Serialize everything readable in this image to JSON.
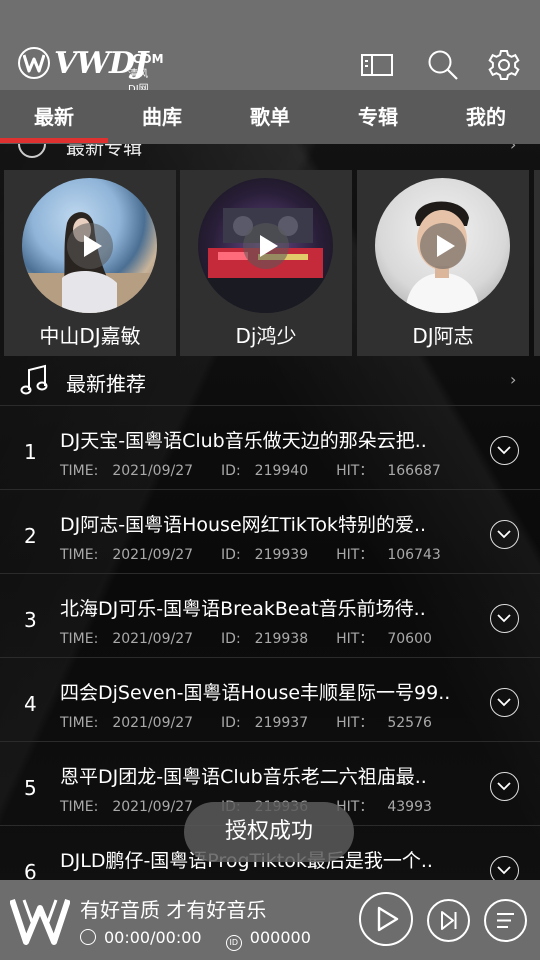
{
  "app": {
    "logo_text": "VWDJ",
    "logo_com": ".COM",
    "logo_sub": "清风DJ网"
  },
  "tabs": [
    {
      "label": "最新",
      "active": true
    },
    {
      "label": "曲库"
    },
    {
      "label": "歌单"
    },
    {
      "label": "专辑"
    },
    {
      "label": "我的"
    }
  ],
  "albums_section": {
    "title": "最新专辑",
    "items": [
      {
        "name": "中山DJ嘉敏"
      },
      {
        "name": "Dj鸿少"
      },
      {
        "name": "DJ阿志"
      }
    ]
  },
  "recommend_section": {
    "title": "最新推荐",
    "time_label": "TIME:",
    "id_label": "ID:",
    "hit_label": "HIT：",
    "items": [
      {
        "num": "1",
        "title": "DJ天宝-国粤语Club音乐做天边的那朵云把..",
        "time": "2021/09/27",
        "id": "219940",
        "hit": "166687"
      },
      {
        "num": "2",
        "title": "DJ阿志-国粤语House网红TikTok特别的爱..",
        "time": "2021/09/27",
        "id": "219939",
        "hit": "106743"
      },
      {
        "num": "3",
        "title": "北海DJ可乐-国粤语BreakBeat音乐前场待..",
        "time": "2021/09/27",
        "id": "219938",
        "hit": "70600"
      },
      {
        "num": "4",
        "title": "四会DjSeven-国粤语House丰顺星际一号99..",
        "time": "2021/09/27",
        "id": "219937",
        "hit": "52576"
      },
      {
        "num": "5",
        "title": "恩平DJ团龙-国粤语Club音乐老二六祖庙最..",
        "time": "2021/09/27",
        "id": "219936",
        "hit": "43993"
      },
      {
        "num": "6",
        "title": "DJLD鹏仔-国粤语ProgTiktok最后是我一个..",
        "time": "",
        "id": "",
        "hit": ""
      }
    ]
  },
  "toast": {
    "text": "授权成功"
  },
  "player": {
    "title": "有好音质 才有好音乐",
    "time": "00:00/00:00",
    "id": "000000",
    "id_icon": "ID"
  }
}
